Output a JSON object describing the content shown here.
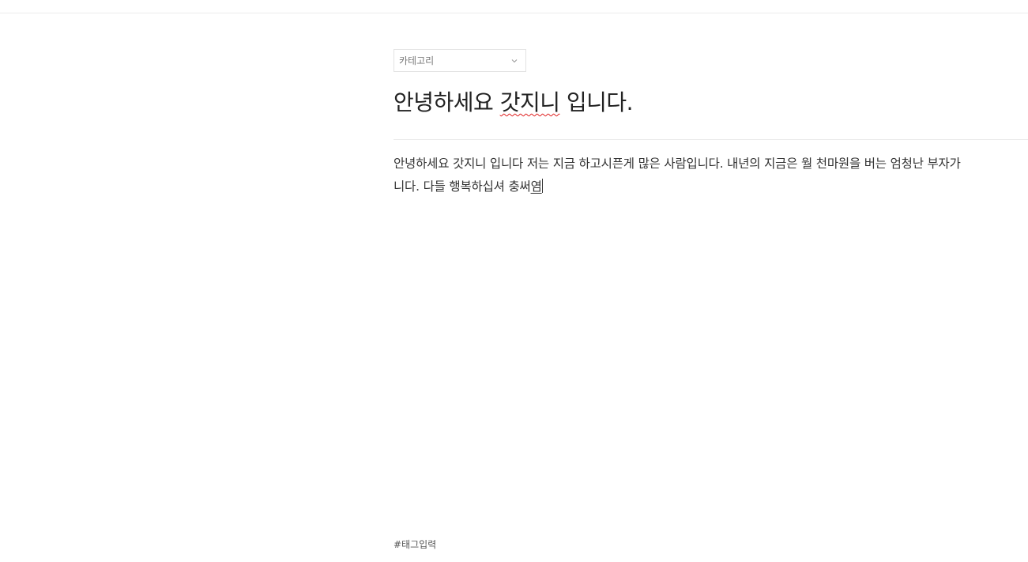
{
  "category": {
    "label": "카테고리",
    "icon": "chevron-down-icon"
  },
  "post": {
    "title_prefix": "안녕하세요 ",
    "title_misspelled": "갓지니",
    "title_suffix": " 입니다.",
    "body_line1": "안녕하세요 갓지니 입니다 저는 지금 하고시픈게 많은 사람입니다. 내년의 지금은 월 천마원을 버는 엄청난 부자가",
    "body_line2_text": "니다. 다들 행복하십셔 충써",
    "body_line2_composing": "염"
  },
  "tags": {
    "placeholder": "#태그입력"
  },
  "colors": {
    "spellcheck": "#e02020",
    "text": "#333333",
    "border": "#e3e3e3"
  }
}
